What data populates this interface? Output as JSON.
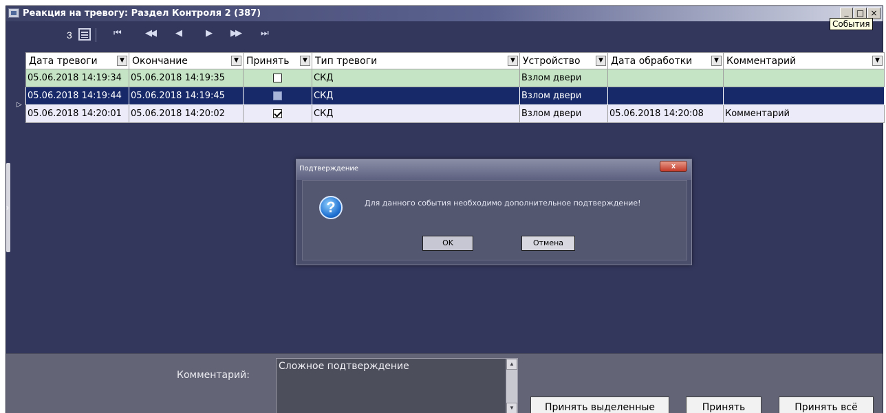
{
  "window": {
    "title": "Реакция на тревогу: Раздел  Контроля 2 (387)",
    "minimize": "_",
    "maximize": "□",
    "close": "×",
    "tooltip": "События"
  },
  "navbar": {
    "count": "3",
    "buttons": [
      "⏮",
      "◀◀",
      "◀",
      "▶",
      "▶▶",
      "⏭"
    ]
  },
  "grid": {
    "columns": [
      "Дата тревоги",
      "Окончание",
      "Принять",
      "Тип тревоги",
      "Устройство",
      "Дата обработки",
      "Комментарий"
    ],
    "rows": [
      {
        "alarm_date": "05.06.2018 14:19:34",
        "end": "05.06.2018 14:19:35",
        "accepted": false,
        "type": "СКД",
        "device": "Взлом двери",
        "processed": "",
        "comment": ""
      },
      {
        "alarm_date": "05.06.2018 14:19:44",
        "end": "05.06.2018 14:19:45",
        "accepted": false,
        "type": "СКД",
        "device": "Взлом двери",
        "processed": "",
        "comment": ""
      },
      {
        "alarm_date": "05.06.2018 14:20:01",
        "end": "05.06.2018 14:20:02",
        "accepted": true,
        "type": "СКД",
        "device": "Взлом двери",
        "processed": "05.06.2018 14:20:08",
        "comment": "Комментарий"
      }
    ],
    "selected_row": 1
  },
  "dialog": {
    "title": "Подтверждение",
    "message": "Для данного события необходимо дополнительное подтверждение!",
    "ok": "OK",
    "cancel": "Отмена"
  },
  "bottom": {
    "comment_label": "Комментарий:",
    "comment_value": "Сложное подтверждение",
    "accept_selected": "Принять выделенные",
    "accept": "Принять",
    "accept_all": "Принять всё"
  },
  "colors": {
    "background": "#33375c",
    "selected_row": "#172968",
    "row_green": "#c5e4c5",
    "row_lavender": "#ecebfa"
  }
}
